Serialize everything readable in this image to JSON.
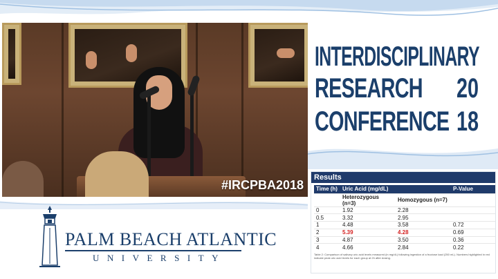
{
  "video": {
    "hashtag": "#IRCPBA2018"
  },
  "conference": {
    "line1": "INTERDISCIPLINARY",
    "line2": "RESEARCH",
    "line3": "CONFERENCE",
    "year_top": "20",
    "year_bottom": "18"
  },
  "slide": {
    "title": "Results",
    "headers": [
      "Time (h)",
      "Uric Acid (mg/dL)",
      "",
      "P-Value"
    ],
    "subheaders": [
      "",
      "Heterozygous (n=3)",
      "Homozygous (n=7)",
      ""
    ],
    "rows": [
      {
        "time": "0",
        "het": "1.92",
        "hom": "2.28",
        "p": ""
      },
      {
        "time": "0.5",
        "het": "3.32",
        "hom": "2.95",
        "p": ""
      },
      {
        "time": "1",
        "het": "4.48",
        "hom": "3.58",
        "p": "0.72"
      },
      {
        "time": "2",
        "het": "5.39",
        "hom": "4.28",
        "p": "0.69"
      },
      {
        "time": "3",
        "het": "4.87",
        "hom": "3.50",
        "p": "0.36"
      },
      {
        "time": "4",
        "het": "4.66",
        "hom": "2.84",
        "p": "0.22"
      }
    ],
    "highlight_color": "#d41f1f",
    "caption": "Table 2: Comparison of salivary uric acid levels measured (in mg/dL) following ingestion of a fructose load (250 mL). Numbers highlighted in red indicate peak uric acid levels for each group at 2h after dosing."
  },
  "logo": {
    "name": "PALM BEACH ATLANTIC",
    "subtitle": "UNIVERSITY",
    "icon": "lighthouse-icon"
  },
  "colors": {
    "brand_navy": "#1b3f6b",
    "header_navy": "#1f3a6a",
    "wave_light": "#c8dcf0"
  }
}
